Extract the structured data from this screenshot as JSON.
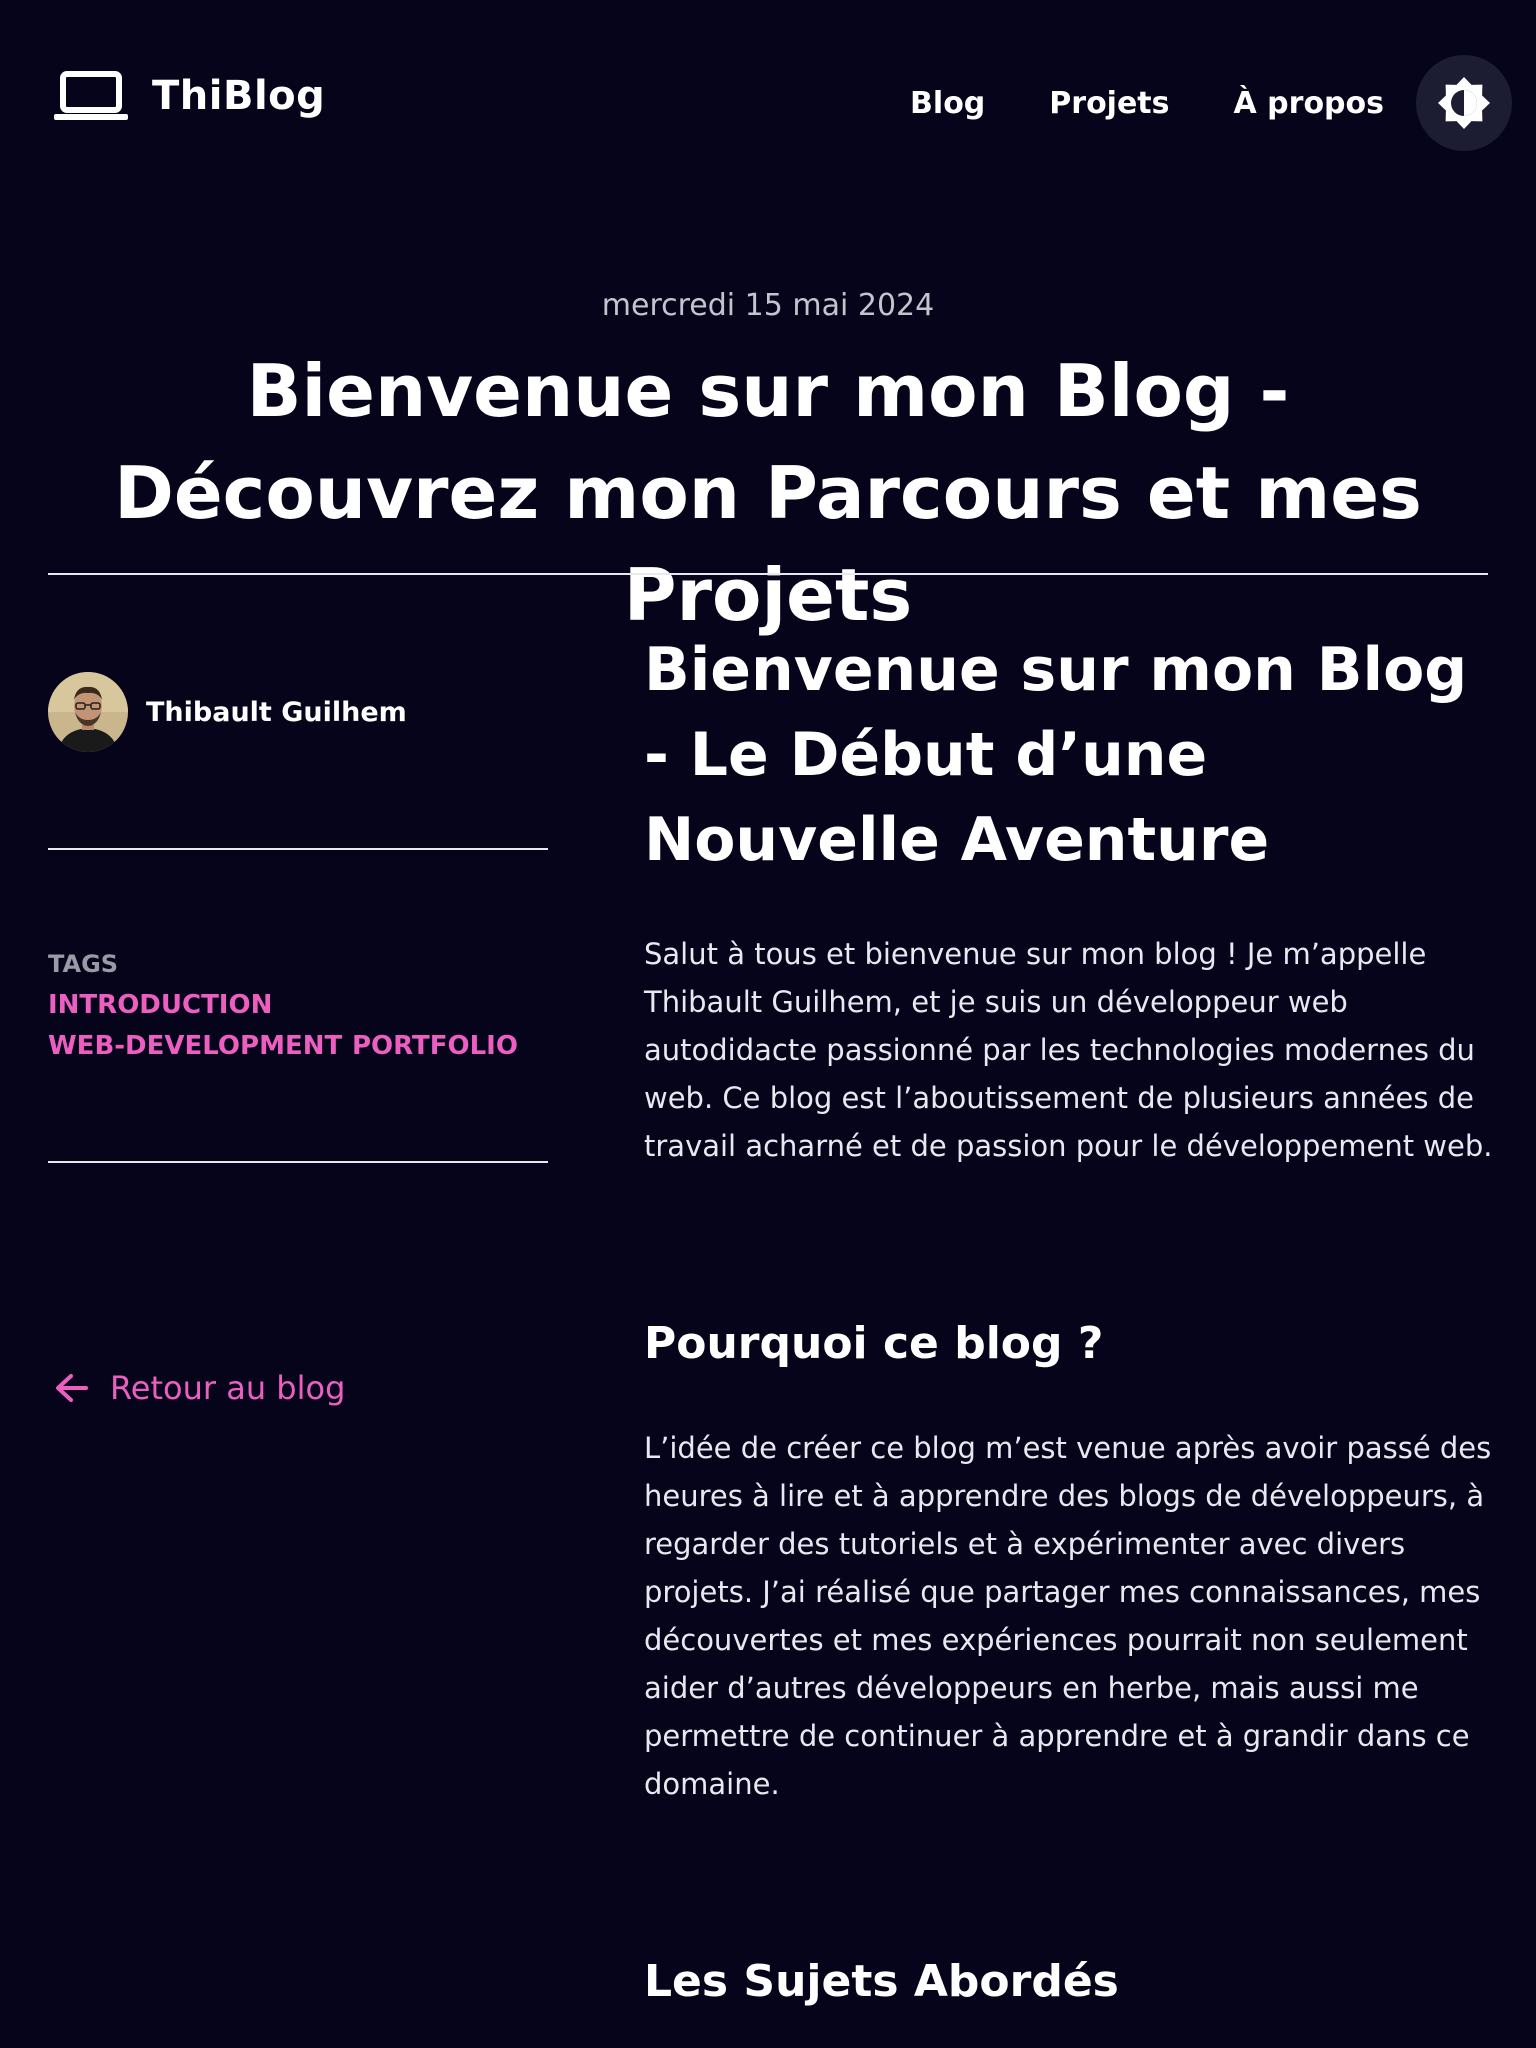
{
  "header": {
    "logo_text": "ThiBlog",
    "nav": [
      "Blog",
      "Projets",
      "À propos"
    ]
  },
  "post": {
    "date": "mercredi 15 mai 2024",
    "title": "Bienvenue sur mon Blog - Découvrez mon Parcours et mes Projets"
  },
  "sidebar": {
    "author_name": "Thibault Guilhem",
    "tags_label": "TAGS",
    "tags": [
      "INTRODUCTION",
      "WEB-DEVELOPMENT",
      "PORTFOLIO"
    ],
    "back_label": "Retour au blog"
  },
  "content": {
    "heading": "Bienvenue sur mon Blog - Le Début d’une Nouvelle Aventure",
    "intro": "Salut à tous et bienvenue sur mon blog ! Je m’appelle Thibault Guilhem, et je suis un développeur web autodidacte passionné par les technologies modernes du web. Ce blog est l’aboutissement de plusieurs années de travail acharné et de passion pour le développement web.",
    "section1_title": "Pourquoi ce blog ?",
    "section1_text": "L’idée de créer ce blog m’est venue après avoir passé des heures à lire et à apprendre des blogs de développeurs, à regarder des tutoriels et à expérimenter avec divers projets. J’ai réalisé que partager mes connaissances, mes découvertes et mes expériences pourrait non seulement aider d’autres développeurs en herbe, mais aussi me permettre de continuer à apprendre et à grandir dans ce domaine.",
    "section2_title": "Les Sujets Abordés"
  },
  "colors": {
    "background": "#05041a",
    "accent": "#ec5ec0",
    "text": "#ffffff"
  },
  "icons": {
    "logo": "laptop-icon",
    "theme": "brightness-icon",
    "back": "arrow-left-icon"
  }
}
